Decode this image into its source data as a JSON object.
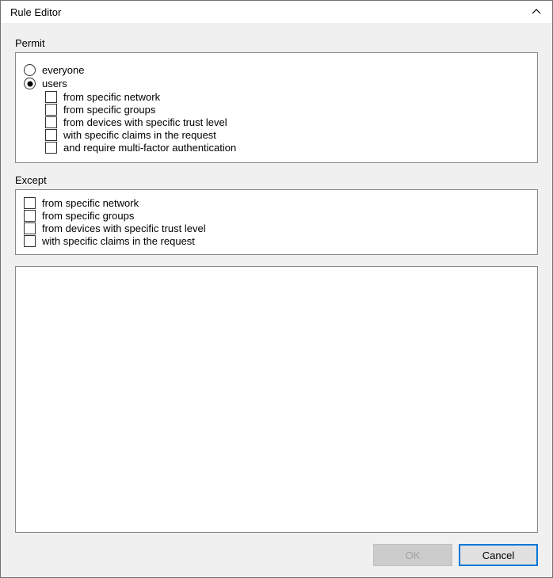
{
  "titlebar": {
    "title": "Rule Editor"
  },
  "permit": {
    "label": "Permit",
    "radios": {
      "everyone": "everyone",
      "users": "users"
    },
    "selected": "users",
    "user_checks": [
      "from specific network",
      "from specific groups",
      "from devices with specific trust level",
      "with specific claims in the request",
      "and require multi-factor authentication"
    ]
  },
  "except": {
    "label": "Except",
    "checks": [
      "from specific network",
      "from specific groups",
      "from devices with specific trust level",
      "with specific claims in the request"
    ]
  },
  "buttons": {
    "ok": "OK",
    "cancel": "Cancel"
  }
}
